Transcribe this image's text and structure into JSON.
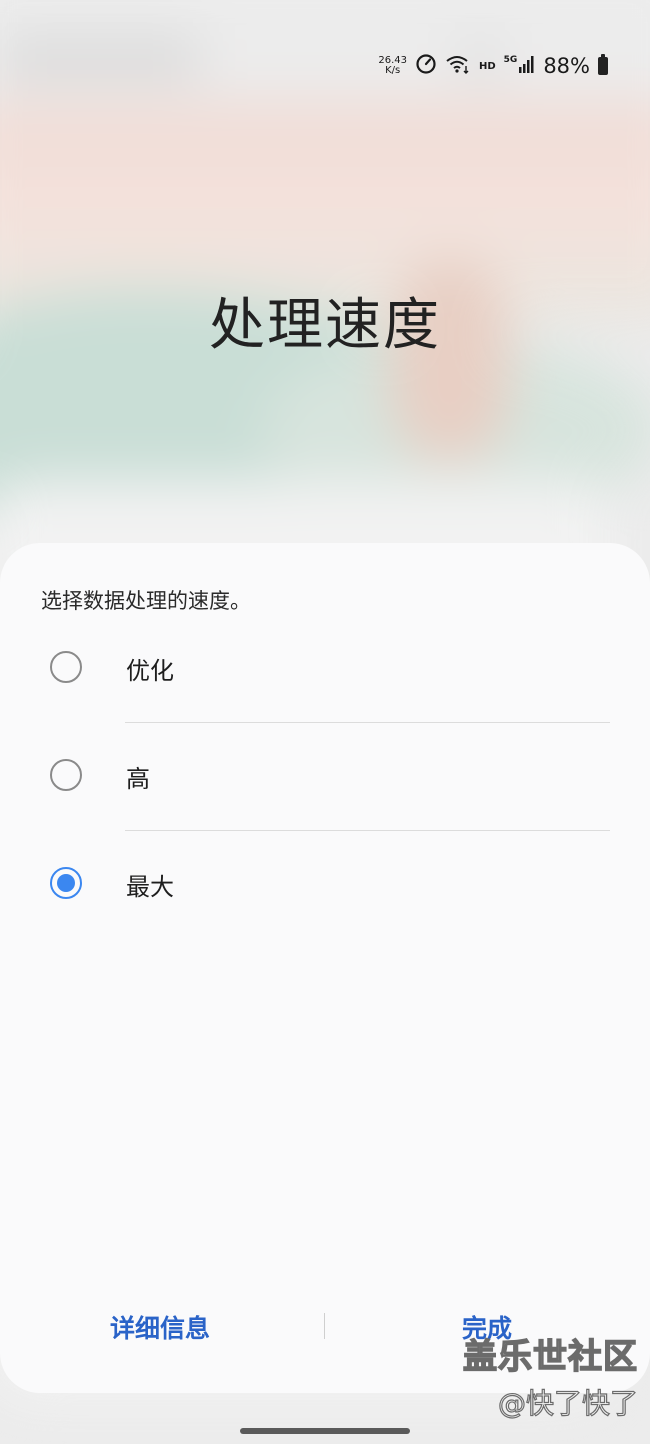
{
  "status_bar": {
    "net_speed_value": "26.43",
    "net_speed_unit": "K/s",
    "hd": "HD",
    "network": "5G",
    "battery": "88%"
  },
  "page": {
    "title": "处理速度"
  },
  "dialog": {
    "description": "选择数据处理的速度。",
    "options": [
      {
        "label": "优化",
        "selected": false
      },
      {
        "label": "高",
        "selected": false
      },
      {
        "label": "最大",
        "selected": true
      }
    ],
    "details_button": "详细信息",
    "done_button": "完成",
    "accent_color": "#3b87f0",
    "button_color": "#2a63c8"
  },
  "watermark": {
    "logo": "盖乐世社区",
    "handle": "@快了快了"
  }
}
